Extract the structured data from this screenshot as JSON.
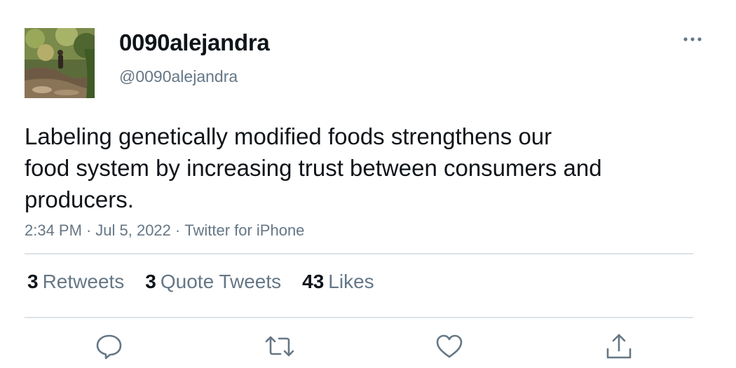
{
  "user": {
    "display_name": "0090alejandra",
    "handle": "@0090alejandra",
    "avatar_icon": "profile-photo"
  },
  "tweet": {
    "text_lines": [
      "Labeling genetically modified foods strengthens our",
      "food system by increasing trust between consumers and",
      "producers."
    ],
    "time": "2:34 PM",
    "date": "Jul 5, 2022",
    "source": "Twitter for iPhone",
    "separator": "·"
  },
  "stats": {
    "retweets": {
      "count": "3",
      "label": "Retweets"
    },
    "quote_tweets": {
      "count": "3",
      "label": "Quote Tweets"
    },
    "likes": {
      "count": "43",
      "label": "Likes"
    }
  },
  "actions": [
    "reply-icon",
    "retweet-icon",
    "like-icon",
    "share-icon"
  ],
  "colors": {
    "text": "#0f1419",
    "secondary": "#657786",
    "divider": "#dde3e8"
  }
}
